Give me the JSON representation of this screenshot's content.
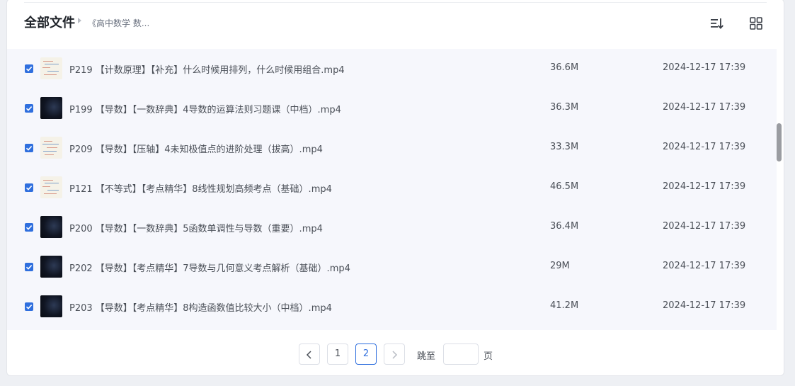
{
  "header": {
    "title": "全部文件",
    "breadcrumb": "《高中数学 数..."
  },
  "files": [
    {
      "name": "P219 【计数原理】【补充】什么时候用排列，什么时候用组合.mp4",
      "size": "36.6M",
      "date": "2024-12-17 17:39",
      "thumb": "light",
      "checked": true
    },
    {
      "name": "P199 【导数】【一数辞典】4导数的运算法则习题课（中档）.mp4",
      "size": "36.3M",
      "date": "2024-12-17 17:39",
      "thumb": "dark",
      "checked": true
    },
    {
      "name": "P209 【导数】【压轴】4未知极值点的进阶处理（拔高）.mp4",
      "size": "33.3M",
      "date": "2024-12-17 17:39",
      "thumb": "light",
      "checked": true
    },
    {
      "name": "P121 【不等式】【考点精华】8线性规划高频考点（基础）.mp4",
      "size": "46.5M",
      "date": "2024-12-17 17:39",
      "thumb": "light",
      "checked": true
    },
    {
      "name": "P200 【导数】【一数辞典】5函数单调性与导数（重要）.mp4",
      "size": "36.4M",
      "date": "2024-12-17 17:39",
      "thumb": "dark",
      "checked": true
    },
    {
      "name": "P202 【导数】【考点精华】7导数与几何意义考点解析（基础）.mp4",
      "size": "29M",
      "date": "2024-12-17 17:39",
      "thumb": "dark",
      "checked": true
    },
    {
      "name": "P203 【导数】【考点精华】8构造函数值比较大小（中档）.mp4",
      "size": "41.2M",
      "date": "2024-12-17 17:39",
      "thumb": "dark",
      "checked": true
    }
  ],
  "pagination": {
    "pages": [
      "1",
      "2"
    ],
    "current": "2",
    "jump_label": "跳至",
    "jump_value": "",
    "page_unit": "页"
  },
  "colors": {
    "accent": "#2f6fde",
    "list_bg": "#f6f7fc"
  },
  "icons": {
    "sort": "sort-icon",
    "grid": "grid-view-icon",
    "prev": "chevron-left-icon",
    "next": "chevron-right-icon",
    "check": "check-icon",
    "breadcrumb_sep": "caret-right-icon"
  }
}
